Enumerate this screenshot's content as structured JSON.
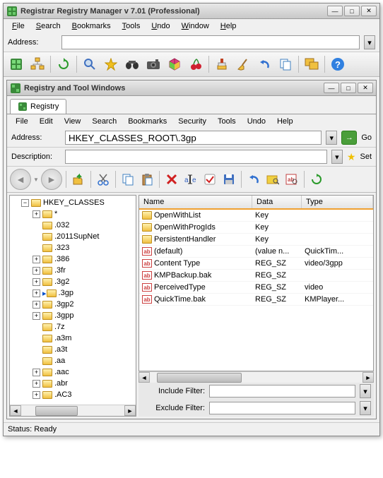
{
  "outer": {
    "title": "Registrar Registry Manager v 7.01 (Professional)",
    "menu": [
      "File",
      "Search",
      "Bookmarks",
      "Tools",
      "Undo",
      "Window",
      "Help"
    ],
    "address_label": "Address:",
    "address_value": ""
  },
  "inner": {
    "title": "Registry and Tool Windows",
    "tab_label": "Registry",
    "menu": [
      "File",
      "Edit",
      "View",
      "Search",
      "Bookmarks",
      "Security",
      "Tools",
      "Undo",
      "Help"
    ],
    "address_label": "Address:",
    "address_value": "HKEY_CLASSES_ROOT\\.3gp",
    "go_label": "Go",
    "description_label": "Description:",
    "description_value": "",
    "set_label": "Set",
    "include_filter_label": "Include Filter:",
    "exclude_filter_label": "Exclude Filter:",
    "include_filter_value": "",
    "exclude_filter_value": ""
  },
  "tree": {
    "root": "HKEY_CLASSES",
    "children": [
      "*",
      ".032",
      ".2011SupNet",
      ".323",
      ".386",
      ".3fr",
      ".3g2",
      ".3gp",
      ".3gp2",
      ".3gpp",
      ".7z",
      ".a3m",
      ".a3t",
      ".aa",
      ".aac",
      ".abr",
      ".AC3"
    ],
    "selected": ".3gp"
  },
  "list": {
    "headers": [
      "Name",
      "Data",
      "Type"
    ],
    "rows": [
      {
        "icon": "folder",
        "name": "OpenWithList",
        "data": "Key",
        "type": ""
      },
      {
        "icon": "folder",
        "name": "OpenWithProgIds",
        "data": "Key",
        "type": ""
      },
      {
        "icon": "folder",
        "name": "PersistentHandler",
        "data": "Key",
        "type": ""
      },
      {
        "icon": "ab",
        "name": "(default)",
        "data": "(value n...",
        "type": "QuickTim..."
      },
      {
        "icon": "ab",
        "name": "Content Type",
        "data": "REG_SZ",
        "type": "video/3gpp"
      },
      {
        "icon": "ab",
        "name": "KMPBackup.bak",
        "data": "REG_SZ",
        "type": ""
      },
      {
        "icon": "ab",
        "name": "PerceivedType",
        "data": "REG_SZ",
        "type": "video"
      },
      {
        "icon": "ab",
        "name": "QuickTime.bak",
        "data": "REG_SZ",
        "type": "KMPlayer..."
      }
    ]
  },
  "status": "Status: Ready",
  "outer_toolbar": [
    "tree-icon",
    "hierarchy-icon",
    "refresh-icon",
    "sep",
    "search-icon",
    "star-icon",
    "binoculars-icon",
    "camera-icon",
    "cube-icon",
    "cherry-icon",
    "sep",
    "brush-icon",
    "broom-icon",
    "undo-icon",
    "copy-icon",
    "sep",
    "windows-icon",
    "sep",
    "help-icon"
  ],
  "inner_toolbar": [
    "up-icon",
    "sep",
    "cut-icon",
    "sep",
    "copy-icon",
    "paste-icon",
    "sep",
    "delete-icon",
    "rename-icon",
    "check-icon",
    "save-icon",
    "sep",
    "undo-icon",
    "find-icon",
    "find-text-icon",
    "sep",
    "refresh-icon"
  ]
}
